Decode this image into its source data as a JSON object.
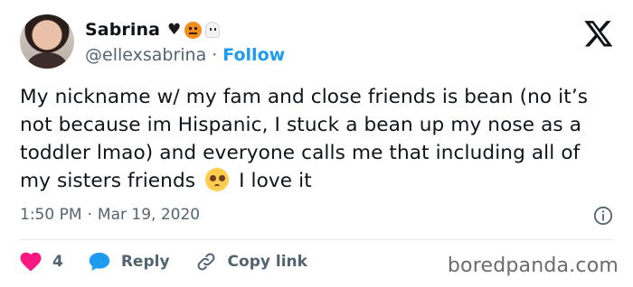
{
  "author": {
    "name": "Sabrina",
    "handle": "@ellexsabrina",
    "follow_label": "Follow",
    "name_emojis": [
      "black-heart",
      "jack-o-lantern",
      "ghost"
    ]
  },
  "tweet": {
    "text_before_emoji": "My nickname w/ my fam and close friends is bean (no it’s not because im Hispanic, I stuck a bean up my nose as a toddler lmao) and everyone calls me that including all of my sisters friends",
    "emoji": "pleading-face",
    "text_after_emoji": "I love it",
    "time": "1:50 PM",
    "separator": "·",
    "date": "Mar 19, 2020"
  },
  "actions": {
    "like_count": "4",
    "reply_label": "Reply",
    "copy_link_label": "Copy link"
  },
  "watermark": "boredpanda.com",
  "colors": {
    "accent": "#1d9bf0",
    "like": "#f91880",
    "text": "#0f1419",
    "muted": "#536471"
  }
}
